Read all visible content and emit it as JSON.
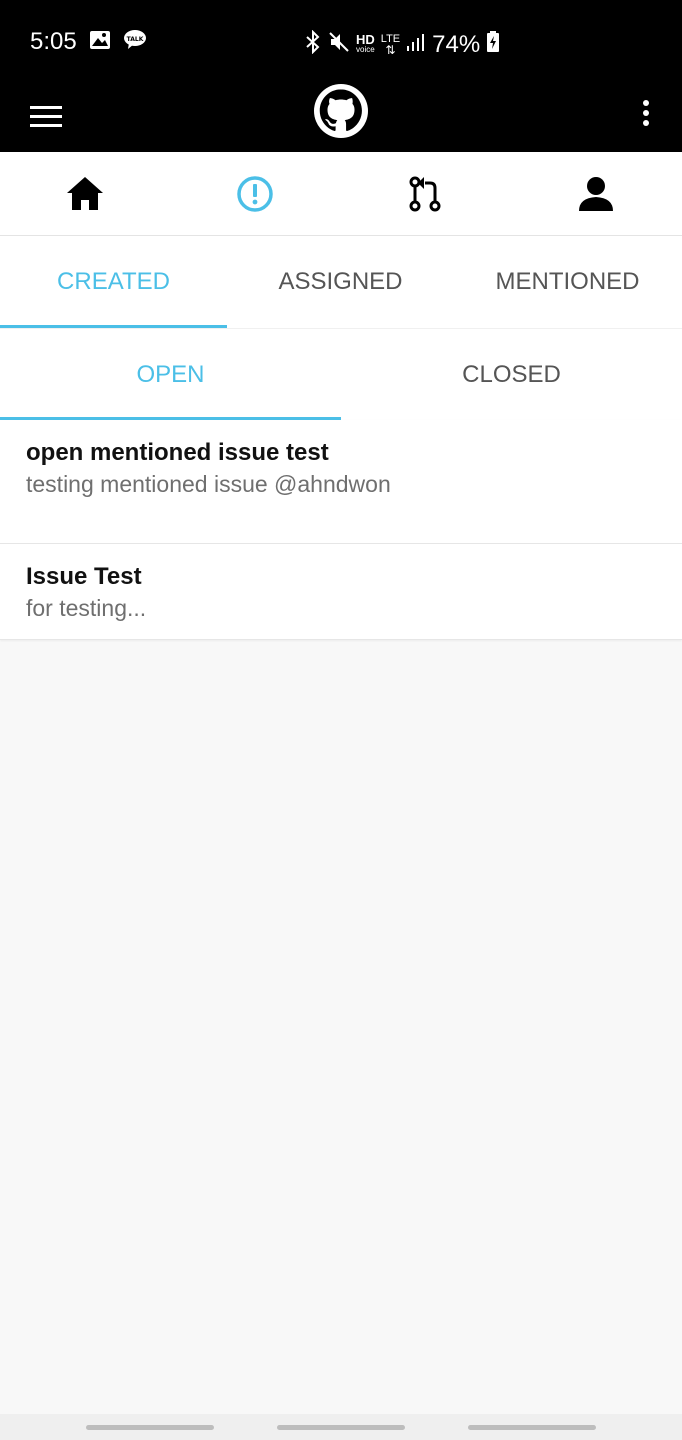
{
  "status_bar": {
    "time": "5:05",
    "battery": "74%",
    "network": "LTE",
    "hd_label": "HD",
    "voice_label": "voice",
    "talk_label": "TALK"
  },
  "app_bar": {
    "menu_icon": "hamburger-icon",
    "logo_icon": "github-logo",
    "overflow_icon": "more-vertical-icon"
  },
  "top_nav": {
    "items": [
      {
        "icon": "home-icon",
        "active": false
      },
      {
        "icon": "issue-icon",
        "active": true
      },
      {
        "icon": "pull-request-icon",
        "active": false
      },
      {
        "icon": "profile-icon",
        "active": false
      }
    ],
    "active_color": "#4bbfe7"
  },
  "tabs": {
    "primary": [
      {
        "label": "CREATED",
        "active": true
      },
      {
        "label": "ASSIGNED",
        "active": false
      },
      {
        "label": "MENTIONED",
        "active": false
      }
    ],
    "secondary": [
      {
        "label": "OPEN",
        "active": true
      },
      {
        "label": "CLOSED",
        "active": false
      }
    ]
  },
  "issues": [
    {
      "title": "open mentioned issue test",
      "body": "testing mentioned issue @ahndwon"
    },
    {
      "title": "Issue Test",
      "body": "for testing..."
    }
  ]
}
